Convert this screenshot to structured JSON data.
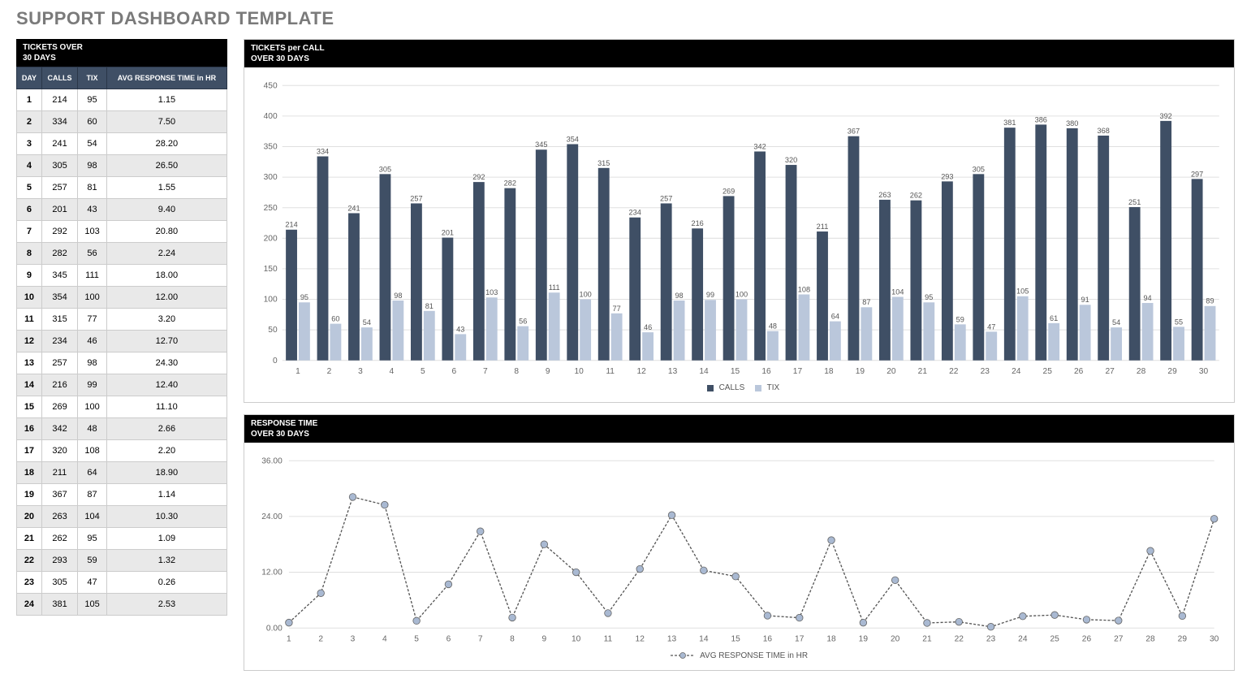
{
  "title": "SUPPORT DASHBOARD TEMPLATE",
  "table": {
    "header_title": "TICKETS OVER\n30 DAYS",
    "columns": [
      "DAY",
      "CALLS",
      "TIX",
      "AVG RESPONSE TIME in HR"
    ],
    "rows": [
      [
        "1",
        "214",
        "95",
        "1.15"
      ],
      [
        "2",
        "334",
        "60",
        "7.50"
      ],
      [
        "3",
        "241",
        "54",
        "28.20"
      ],
      [
        "4",
        "305",
        "98",
        "26.50"
      ],
      [
        "5",
        "257",
        "81",
        "1.55"
      ],
      [
        "6",
        "201",
        "43",
        "9.40"
      ],
      [
        "7",
        "292",
        "103",
        "20.80"
      ],
      [
        "8",
        "282",
        "56",
        "2.24"
      ],
      [
        "9",
        "345",
        "111",
        "18.00"
      ],
      [
        "10",
        "354",
        "100",
        "12.00"
      ],
      [
        "11",
        "315",
        "77",
        "3.20"
      ],
      [
        "12",
        "234",
        "46",
        "12.70"
      ],
      [
        "13",
        "257",
        "98",
        "24.30"
      ],
      [
        "14",
        "216",
        "99",
        "12.40"
      ],
      [
        "15",
        "269",
        "100",
        "11.10"
      ],
      [
        "16",
        "342",
        "48",
        "2.66"
      ],
      [
        "17",
        "320",
        "108",
        "2.20"
      ],
      [
        "18",
        "211",
        "64",
        "18.90"
      ],
      [
        "19",
        "367",
        "87",
        "1.14"
      ],
      [
        "20",
        "263",
        "104",
        "10.30"
      ],
      [
        "21",
        "262",
        "95",
        "1.09"
      ],
      [
        "22",
        "293",
        "59",
        "1.32"
      ],
      [
        "23",
        "305",
        "47",
        "0.26"
      ],
      [
        "24",
        "381",
        "105",
        "2.53"
      ]
    ]
  },
  "bar_chart": {
    "header_title": "TICKETS per CALL\nOVER 30 DAYS",
    "legend": {
      "series1": "CALLS",
      "series2": "TIX"
    },
    "colors": {
      "calls": "#3f4f65",
      "tix": "#bac7db"
    }
  },
  "line_chart": {
    "header_title": "RESPONSE TIME\nOVER 30 DAYS",
    "legend": "AVG RESPONSE TIME in HR"
  },
  "chart_data": [
    {
      "type": "bar",
      "title": "TICKETS per CALL OVER 30 DAYS",
      "categories": [
        "1",
        "2",
        "3",
        "4",
        "5",
        "6",
        "7",
        "8",
        "9",
        "10",
        "11",
        "12",
        "13",
        "14",
        "15",
        "16",
        "17",
        "18",
        "19",
        "20",
        "21",
        "22",
        "23",
        "24",
        "25",
        "26",
        "27",
        "28",
        "29",
        "30"
      ],
      "series": [
        {
          "name": "CALLS",
          "values": [
            214,
            334,
            241,
            305,
            257,
            201,
            292,
            282,
            345,
            354,
            315,
            234,
            257,
            216,
            269,
            342,
            320,
            211,
            367,
            263,
            262,
            293,
            305,
            381,
            386,
            380,
            368,
            251,
            392,
            297
          ]
        },
        {
          "name": "TIX",
          "values": [
            95,
            60,
            54,
            98,
            81,
            43,
            103,
            56,
            111,
            100,
            77,
            46,
            98,
            99,
            100,
            48,
            108,
            64,
            87,
            104,
            95,
            59,
            47,
            105,
            61,
            91,
            54,
            94,
            55,
            89
          ]
        }
      ],
      "ylim": [
        0,
        450
      ],
      "yticks": [
        0,
        50,
        100,
        150,
        200,
        250,
        300,
        350,
        400,
        450
      ]
    },
    {
      "type": "line",
      "title": "RESPONSE TIME OVER 30 DAYS",
      "categories": [
        "1",
        "2",
        "3",
        "4",
        "5",
        "6",
        "7",
        "8",
        "9",
        "10",
        "11",
        "12",
        "13",
        "14",
        "15",
        "16",
        "17",
        "18",
        "19",
        "20",
        "21",
        "22",
        "23",
        "24",
        "25",
        "26",
        "27",
        "28",
        "29",
        "30"
      ],
      "series": [
        {
          "name": "AVG RESPONSE TIME in HR",
          "values": [
            1.15,
            7.5,
            28.2,
            26.5,
            1.55,
            9.4,
            20.8,
            2.24,
            18.0,
            12.0,
            3.2,
            12.7,
            24.3,
            12.4,
            11.1,
            2.66,
            2.2,
            18.9,
            1.14,
            10.3,
            1.09,
            1.32,
            0.26,
            2.53,
            2.8,
            1.8,
            1.6,
            16.6,
            2.6,
            23.5
          ]
        }
      ],
      "ylim": [
        0,
        36
      ],
      "yticks": [
        0.0,
        12.0,
        24.0,
        36.0
      ]
    }
  ]
}
